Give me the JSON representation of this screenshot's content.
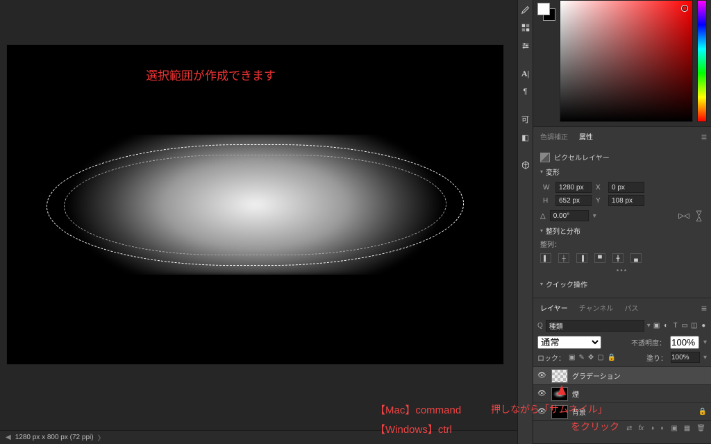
{
  "canvas": {
    "annotation_main": "選択範囲が作成できます",
    "annotation_mac": "【Mac】command",
    "annotation_win": "【Windows】ctrl",
    "annotation_thumb_line1": "押しながら「サムネイル」",
    "annotation_thumb_line2": "をクリック"
  },
  "statusbar": {
    "doc_info": "1280 px x 800 px (72 ppi)"
  },
  "panels": {
    "color_tab1": "色調補正",
    "properties_tab": "属性",
    "properties": {
      "type_label": "ピクセルレイヤー",
      "transform_title": "変形",
      "w_label": "W",
      "w_value": "1280 px",
      "x_label": "X",
      "x_value": "0 px",
      "h_label": "H",
      "h_value": "652 px",
      "y_label": "Y",
      "y_value": "108 px",
      "angle_value": "0.00°",
      "align_title": "整列と分布",
      "align_sub": "整列：",
      "quick_title": "クイック操作"
    },
    "layers": {
      "tab_layers": "レイヤー",
      "tab_channels": "チャンネル",
      "tab_paths": "パス",
      "search_placeholder": "種類",
      "blend_mode": "通常",
      "opacity_label": "不透明度：",
      "opacity_value": "100%",
      "lock_label": "ロック：",
      "fill_label": "塗り：",
      "fill_value": "100%",
      "items": [
        {
          "name": "グラデーション"
        },
        {
          "name": "煙"
        },
        {
          "name": "背景"
        }
      ]
    }
  }
}
